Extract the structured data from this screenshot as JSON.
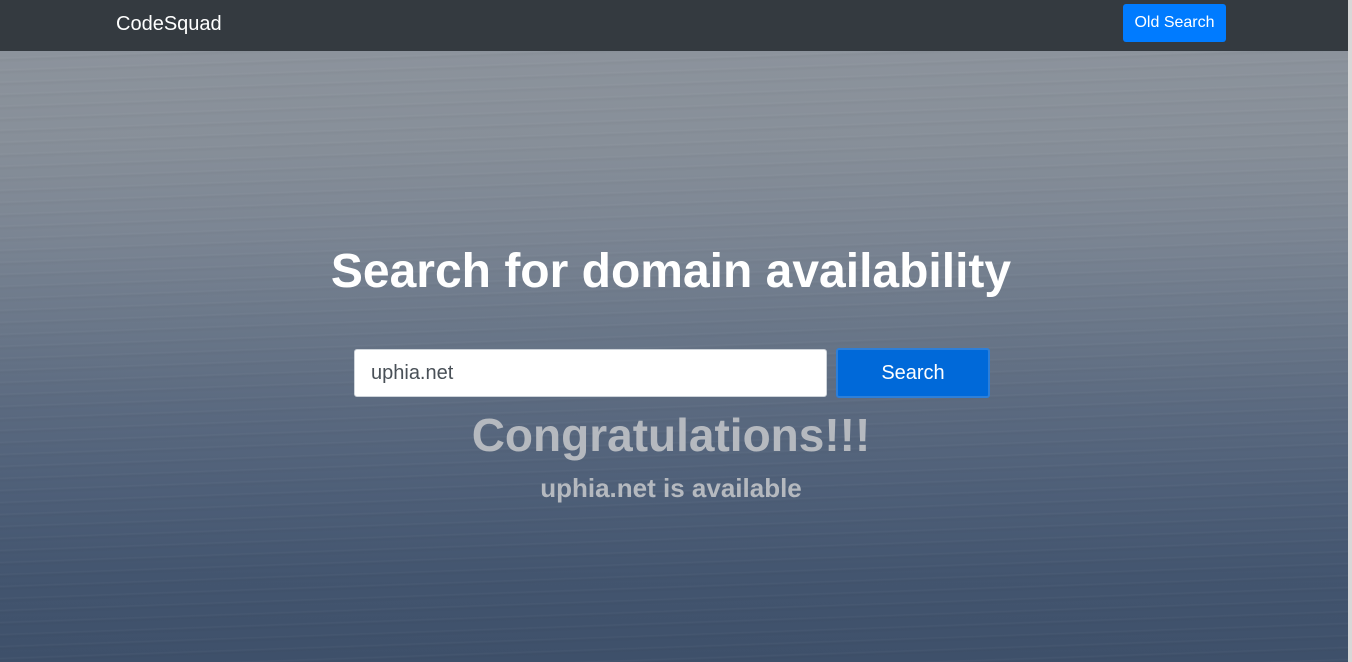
{
  "navbar": {
    "brand": "CodeSquad",
    "old_search_label": "Old Search"
  },
  "hero": {
    "title": "Search for domain availability",
    "search": {
      "value": "uphia.net",
      "button_label": "Search"
    },
    "result": {
      "headline": "Congratulations!!!",
      "message": "uphia.net is available"
    }
  },
  "colors": {
    "navbar_bg": "#343a40",
    "primary": "#007bff",
    "result_text": "#b5b9bf"
  }
}
